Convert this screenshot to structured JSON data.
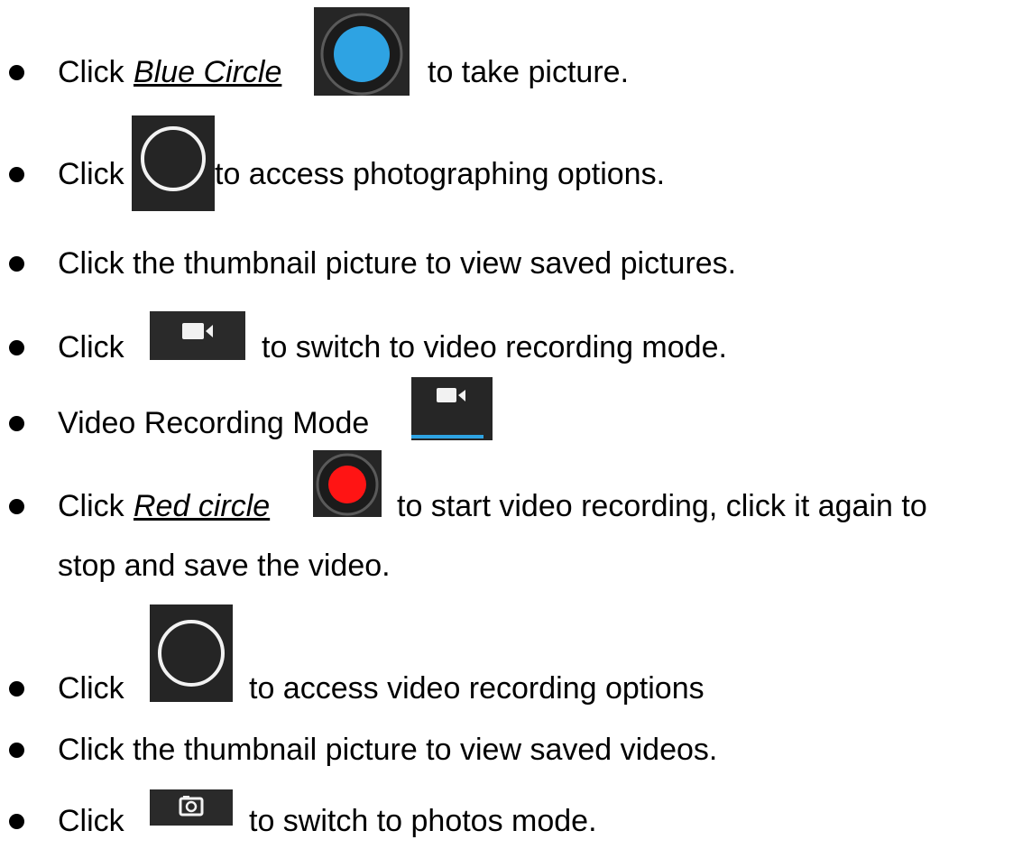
{
  "items": [
    {
      "prefix": "Click ",
      "link": "Blue Circle",
      "after": "to take picture."
    },
    {
      "prefix": "Click",
      "after": "to access photographing options."
    },
    {
      "text": "Click the thumbnail picture to view saved pictures."
    },
    {
      "prefix": "Click",
      "after": "to switch to video recording mode."
    },
    {
      "text": "Video Recording Mode"
    },
    {
      "prefix": "Click ",
      "link": "Red circle",
      "after": "to start video recording, click it again to",
      "line2": "stop and save the video."
    },
    {
      "prefix": "Click",
      "after": "to access video recording options"
    },
    {
      "text": "Click the thumbnail picture to view saved videos."
    },
    {
      "prefix": "Click",
      "after": "to switch to photos mode."
    }
  ],
  "icons": {
    "shutter_photo": "blue-circle-shutter-icon",
    "options": "options-ring-icon",
    "video_switch": "video-camera-icon",
    "video_mode": "video-mode-tab-icon",
    "shutter_video": "red-circle-shutter-icon",
    "photo_switch": "photo-camera-icon"
  },
  "colors": {
    "blue_shutter": "#2ea3e3",
    "red_shutter": "#ff1414",
    "mode_underline": "#2ea3e3",
    "icon_bg": "#2a2a2a"
  }
}
